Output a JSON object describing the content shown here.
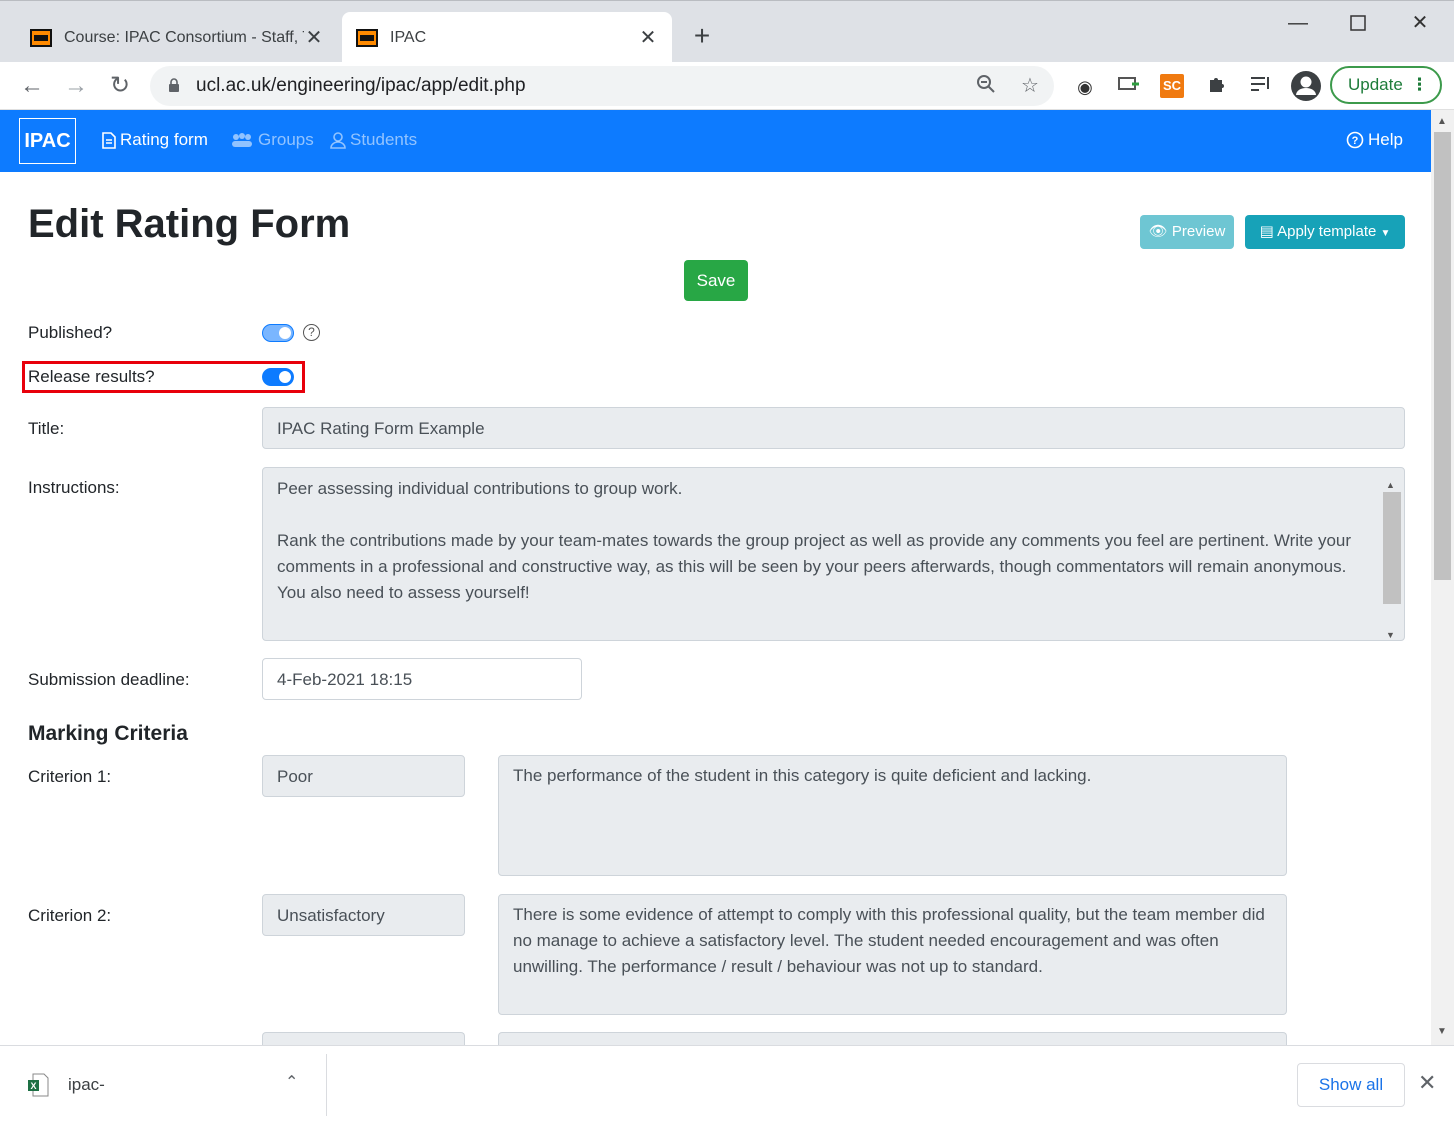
{
  "browser": {
    "tabs": [
      {
        "title": "Course: IPAC Consortium - Staff, T",
        "close": "✕"
      },
      {
        "title": "IPAC",
        "close": "✕"
      }
    ],
    "new_tab": "+",
    "url": "ucl.ac.uk/engineering/ipac/app/edit.php",
    "update_label": "Update",
    "extensions": [
      "SC"
    ]
  },
  "app": {
    "brand": "IPAC",
    "nav": {
      "rating_form": "Rating form",
      "groups": "Groups",
      "students": "Students",
      "help": "Help"
    },
    "colors": {
      "primary": "#0d7bff",
      "info": "#17a2b8",
      "success": "#28a745",
      "highlight": "#e8000b"
    }
  },
  "page": {
    "title": "Edit Rating Form",
    "preview_label": "Preview",
    "apply_template_label": "Apply template",
    "save_label": "Save",
    "published_label": "Published?",
    "published_on": true,
    "release_label": "Release results?",
    "release_on": true,
    "title_label": "Title:",
    "title_value": "IPAC Rating Form Example",
    "instructions_label": "Instructions:",
    "instructions_p1": "Peer assessing individual contributions to group work.",
    "instructions_p2": "Rank the contributions made by your team-mates towards the group project as well as provide any comments you feel are pertinent.  Write your comments in a professional and constructive way, as this will be seen by your peers afterwards, though commentators will remain anonymous.  You also need to assess yourself!",
    "deadline_label": "Submission deadline:",
    "deadline_value": "4-Feb-2021 18:15",
    "marking_criteria_title": "Marking Criteria",
    "criteria": [
      {
        "label": "Criterion 1:",
        "name": "Poor",
        "description": "The performance of the student in this category is quite deficient and lacking."
      },
      {
        "label": "Criterion 2:",
        "name": "Unsatisfactory",
        "description": "There is some evidence of attempt to comply with this professional quality, but the team member did no manage to achieve a satisfactory level.  The student needed encouragement and was often unwilling.  The performance / result / behaviour was not up to standard."
      }
    ]
  },
  "downloads": {
    "file_name": "ipac-",
    "show_all": "Show all"
  }
}
